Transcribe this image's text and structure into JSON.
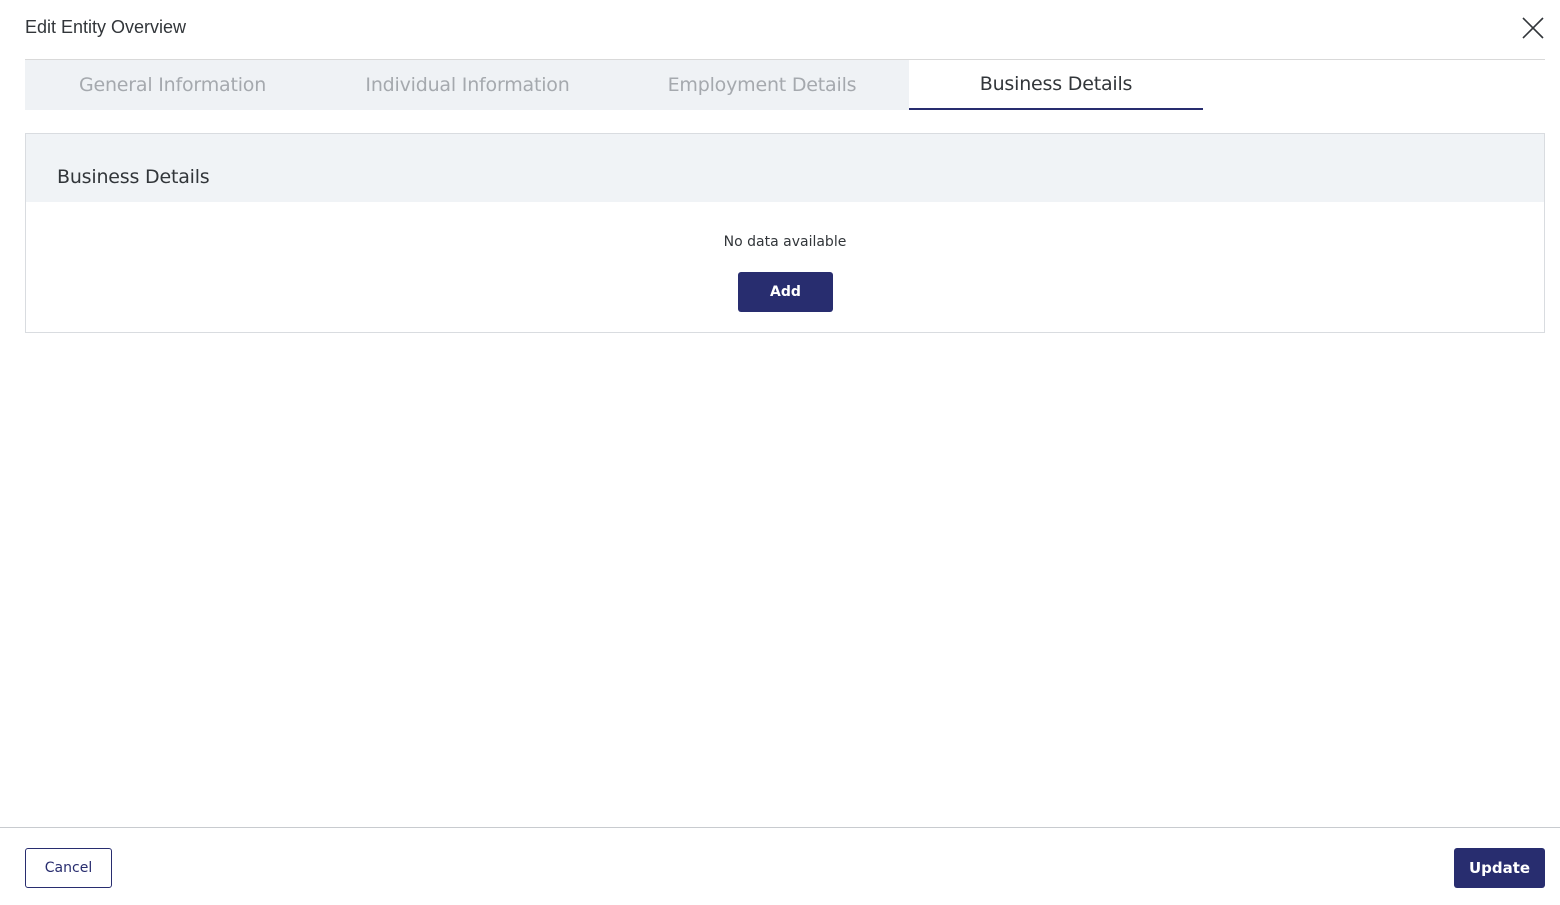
{
  "dialog": {
    "title": "Edit Entity Overview"
  },
  "tabs": [
    {
      "label": "General Information",
      "active": false
    },
    {
      "label": "Individual Information",
      "active": false
    },
    {
      "label": "Employment Details",
      "active": false
    },
    {
      "label": "Business Details",
      "active": true
    }
  ],
  "section": {
    "title": "Business Details",
    "empty_message": "No data available",
    "add_label": "Add"
  },
  "footer": {
    "cancel_label": "Cancel",
    "update_label": "Update"
  },
  "colors": {
    "primary": "#282d6f",
    "tab_inactive_bg": "#eff2f5",
    "tab_inactive_text": "#a5a9ae",
    "section_header_bg": "#f0f3f6"
  },
  "icons": {
    "close": "close-icon"
  }
}
